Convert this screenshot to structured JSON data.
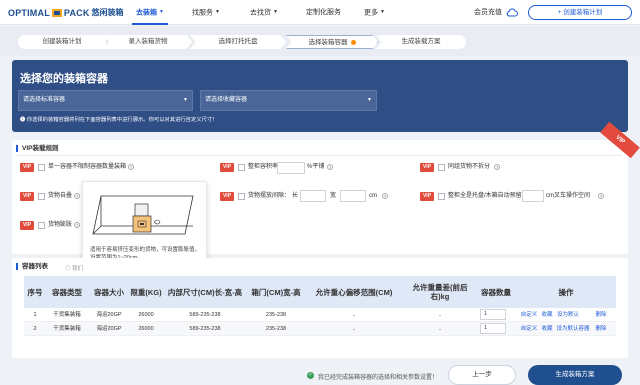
{
  "brand": {
    "name_en_1": "OPTIMAL",
    "name_en_2": "PACK",
    "name_cn": "悠闲装箱"
  },
  "nav": {
    "items": [
      {
        "label": "去装箱",
        "active": true,
        "has_caret": true
      },
      {
        "label": "找服务",
        "active": false,
        "has_caret": true
      },
      {
        "label": "去找货",
        "active": false,
        "has_caret": true
      },
      {
        "label": "定制化服务",
        "active": false,
        "has_caret": false
      },
      {
        "label": "更多",
        "active": false,
        "has_caret": true
      }
    ],
    "member_label": "会员充值",
    "create_plan_label": "+ 创建装箱计划"
  },
  "steps": [
    {
      "label": "创建装箱计划"
    },
    {
      "label": "录入装箱货物"
    },
    {
      "label": "选择打托托盘"
    },
    {
      "label": "选择装箱容器",
      "current": true
    },
    {
      "label": "生成装载方案"
    }
  ],
  "hero": {
    "title": "选择您的装箱容器",
    "select_standard_placeholder": "请选择标准容器",
    "select_favorite_placeholder": "请选择收藏容器",
    "tip": "❶ 你选择的装箱容器将列在下面容器列表中进行展示。你可以对其进行自定义尺寸！"
  },
  "vip": {
    "title": "VIP装载规则",
    "tag": "VIP",
    "ribbon": "VIP",
    "rules": {
      "r1": "单一容器不限制容器数量装箱",
      "r2_a": "整柜容积率≤",
      "r2_b": "%平铺",
      "r3": "同组货物不拆分",
      "r4": "货物自叠",
      "r5_a": "货物摆放间隙：",
      "r5_len": "长",
      "r5_wid": "宽",
      "r5_unit": "cm",
      "r6_a": "整柜全是托盘/木箱自动预留",
      "r6_b": "cm叉车操作空间",
      "r7": "货物膨胀"
    },
    "tooltip_text": "适用于容易挤压变形的货物，可设置膨胀值，设置范围为1~20cm。"
  },
  "list": {
    "title": "容器列表",
    "subtitle": "◎ 我们",
    "headers": [
      "序号",
      "容器类型",
      "容器大小",
      "限重(KG)",
      "内部尺寸(CM)长-宽-高",
      "箱门(CM)宽-高",
      "允许重心偏移范围(CM)",
      "允许重量差(前后右)kg",
      "容器数量",
      "操作"
    ],
    "rows": [
      {
        "no": "1",
        "type": "干货集装箱",
        "size": "海运20GP",
        "limit": "26000",
        "inner": "589-235-238",
        "door": "235-238",
        "offset": "..",
        "diff": "..",
        "qty": "1",
        "ops": [
          "自定义",
          "收藏",
          "设为默认",
          "删除"
        ]
      },
      {
        "no": "2",
        "type": "干货集装箱",
        "size": "海运20GP",
        "limit": "26000",
        "inner": "589-235-238",
        "door": "235-238",
        "offset": "..",
        "diff": "..",
        "qty": "1",
        "ops": [
          "自定义",
          "收藏",
          "设为默认容器",
          "删除"
        ]
      }
    ]
  },
  "footer": {
    "tip": "我已经完成装箱容器的选择和相关参数设置！",
    "prev_label": "上一步",
    "generate_label": "生成装箱方案"
  },
  "colors": {
    "primary": "#1f5bd6",
    "hero_bg": "#2f4e86",
    "vip_red": "#e14c3c",
    "table_head": "#dfe8f7"
  }
}
